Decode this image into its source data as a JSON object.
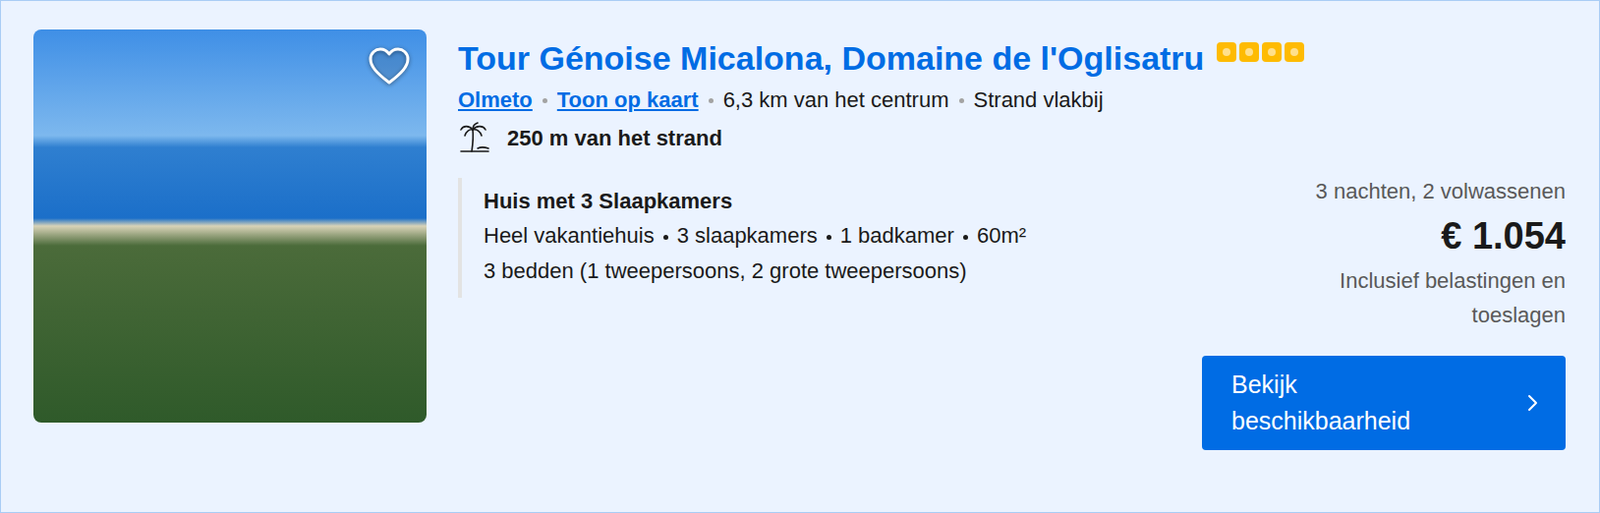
{
  "listing": {
    "title": "Tour Génoise Micalona, Domaine de l'Oglisatru",
    "stars": 4,
    "favorite": false,
    "location_link": "Olmeto",
    "map_link": "Toon op kaart",
    "distance_centre": "6,3 km van het centrum",
    "beach_note": "Strand vlakbij",
    "beach_distance": "250 m van het strand"
  },
  "room": {
    "name": "Huis met 3 Slaapkamers",
    "features": [
      "Heel vakantiehuis",
      "3 slaapkamers",
      "1 badkamer",
      "60m²"
    ],
    "beds": "3 bedden (1 tweepersoons, 2 grote tweepersoons)"
  },
  "price": {
    "stay": "3 nachten, 2 volwassenen",
    "amount": "€ 1.054",
    "note": "Inclusief belastingen en toeslagen"
  },
  "button": {
    "label": "Bekijk beschikbaarheid"
  }
}
